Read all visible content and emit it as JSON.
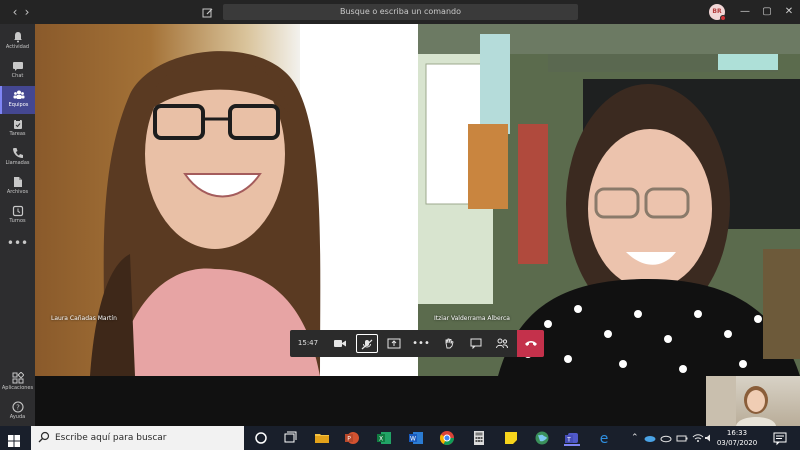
{
  "titlebar": {
    "search_placeholder": "Busque o escriba un comando",
    "avatar_initials": "BR"
  },
  "appbar": {
    "items": [
      {
        "label": "Actividad",
        "icon": "bell-icon"
      },
      {
        "label": "Chat",
        "icon": "chat-icon"
      },
      {
        "label": "Equipos",
        "icon": "teams-icon",
        "active": true
      },
      {
        "label": "Tareas",
        "icon": "tasks-icon"
      },
      {
        "label": "Llamadas",
        "icon": "phone-icon"
      },
      {
        "label": "Archivos",
        "icon": "files-icon"
      },
      {
        "label": "Turnos",
        "icon": "shifts-icon"
      }
    ],
    "bottom": [
      {
        "label": "Aplicaciones",
        "icon": "apps-icon"
      },
      {
        "label": "Ayuda",
        "icon": "help-icon"
      }
    ]
  },
  "call": {
    "participants": [
      {
        "name": "Laura Cañadas Martín"
      },
      {
        "name": "Itziar Valderrama Alberca"
      }
    ],
    "timer": "15:47"
  },
  "taskbar": {
    "search_placeholder": "Escribe aquí para buscar",
    "time": "16:33",
    "date": "03/07/2020"
  },
  "colors": {
    "accent": "#444791",
    "hangup": "#c4314b",
    "taskbar": "#191f2b"
  }
}
